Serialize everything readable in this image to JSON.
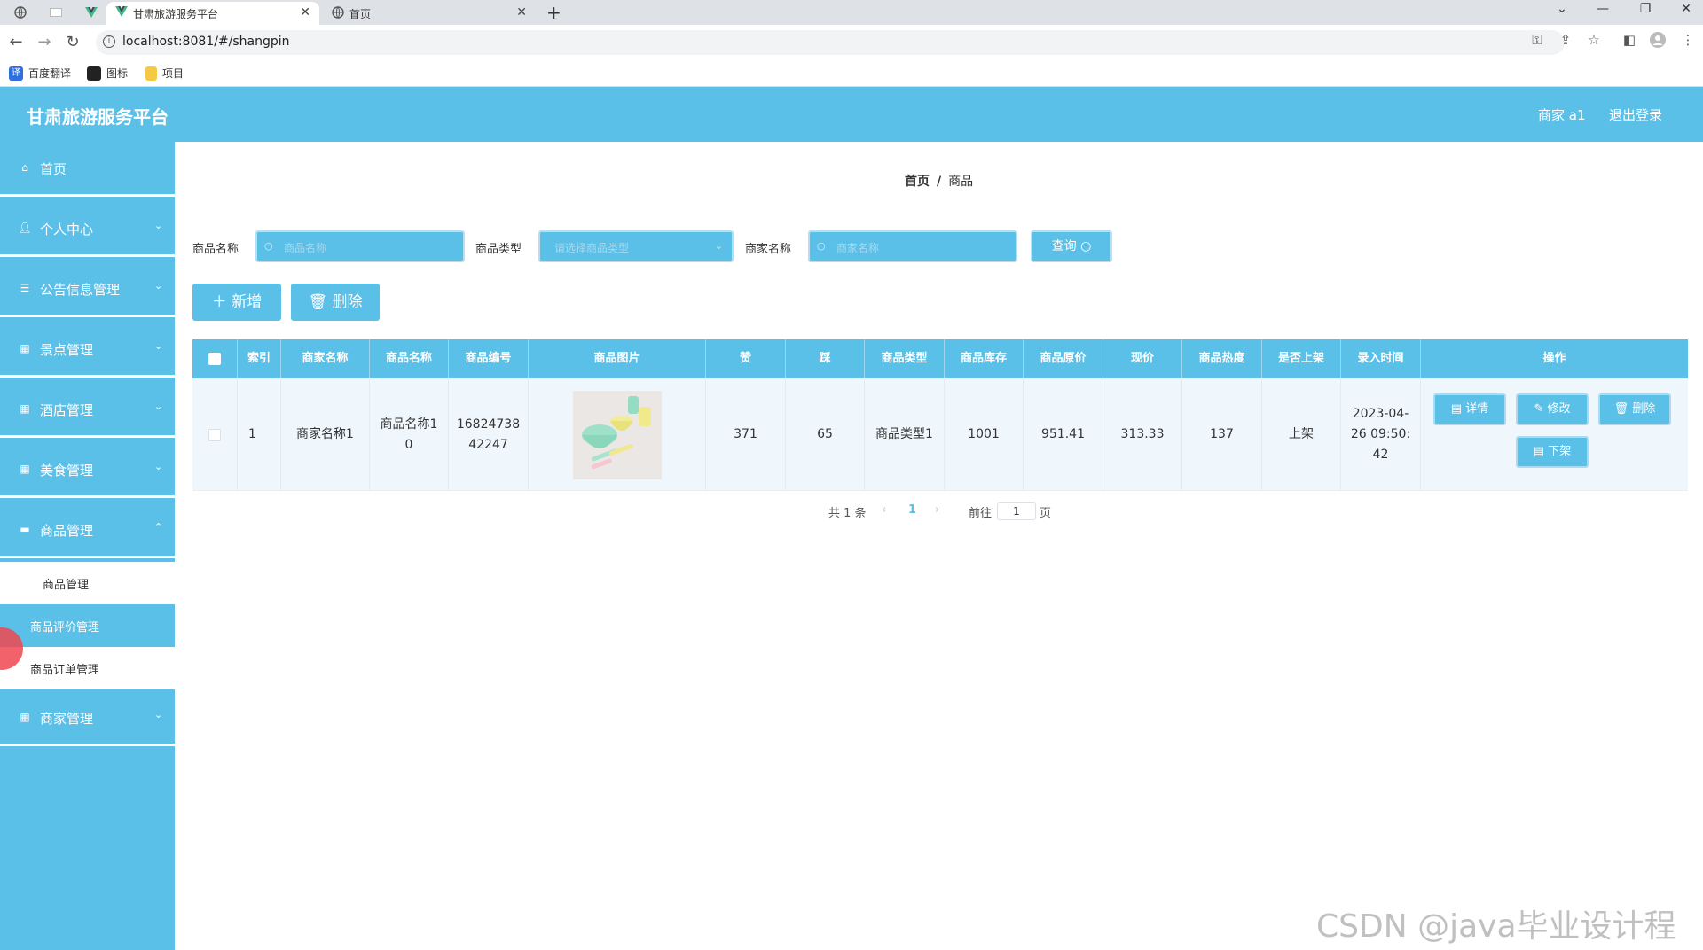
{
  "browser": {
    "tabs": [
      {
        "title": "甘肃旅游服务平台",
        "active": true
      },
      {
        "title": "首页",
        "active": false
      }
    ],
    "url": "localhost:8081/#/shangpin",
    "bookmarks": [
      "百度翻译",
      "图标",
      "项目"
    ]
  },
  "header": {
    "title": "甘肃旅游服务平台",
    "user": "商家 a1",
    "logout": "退出登录",
    "brand_color": "#5bc0e8"
  },
  "sidebar": {
    "items": [
      {
        "label": "首页",
        "icon": "home-icon"
      },
      {
        "label": "个人中心",
        "icon": "user-icon"
      },
      {
        "label": "公告信息管理",
        "icon": "list-icon"
      },
      {
        "label": "景点管理",
        "icon": "grid-icon"
      },
      {
        "label": "酒店管理",
        "icon": "grid-icon"
      },
      {
        "label": "美食管理",
        "icon": "grid-icon"
      },
      {
        "label": "商品管理",
        "icon": "chat-icon"
      },
      {
        "label": "商家管理",
        "icon": "grid-icon"
      }
    ],
    "submenu": [
      "商品管理",
      "商品评价管理",
      "商品订单管理"
    ],
    "active_sub": "商品评价管理"
  },
  "breadcrumb": {
    "home": "首页",
    "separator": "/",
    "current": "商品"
  },
  "search": {
    "name_label": "商品名称",
    "name_placeholder": "商品名称",
    "type_label": "商品类型",
    "type_placeholder": "请选择商品类型",
    "merchant_label": "商家名称",
    "merchant_placeholder": "商家名称",
    "query_label": "查询"
  },
  "actions": {
    "add_label": "新增",
    "delete_label": "删除"
  },
  "table": {
    "headers": [
      "索引",
      "商家名称",
      "商品名称",
      "商品编号",
      "商品图片",
      "赞",
      "踩",
      "商品类型",
      "商品库存",
      "商品原价",
      "现价",
      "商品热度",
      "是否上架",
      "录入时间",
      "操作"
    ],
    "rows": [
      {
        "index": "1",
        "merchant": "商家名称1",
        "name_line1": "商品名称1",
        "name_line2": "0",
        "code_line1": "16824738",
        "code_line2": "42247",
        "likes": "371",
        "dislikes": "65",
        "type": "商品类型1",
        "stock": "1001",
        "original_price": "951.41",
        "price": "313.33",
        "heat": "137",
        "on_shelf": "上架",
        "time_line1": "2023-04-",
        "time_line2": "26 09:50:",
        "time_line3": "42"
      }
    ],
    "op_buttons": {
      "detail": "详情",
      "edit": "修改",
      "delete": "删除",
      "offshelf": "下架"
    }
  },
  "pagination": {
    "total": "共 1 条",
    "current_page": "1",
    "goto_label": "前往",
    "goto_value": "1",
    "page_unit": "页"
  },
  "watermark": "CSDN @java毕业设计程序"
}
